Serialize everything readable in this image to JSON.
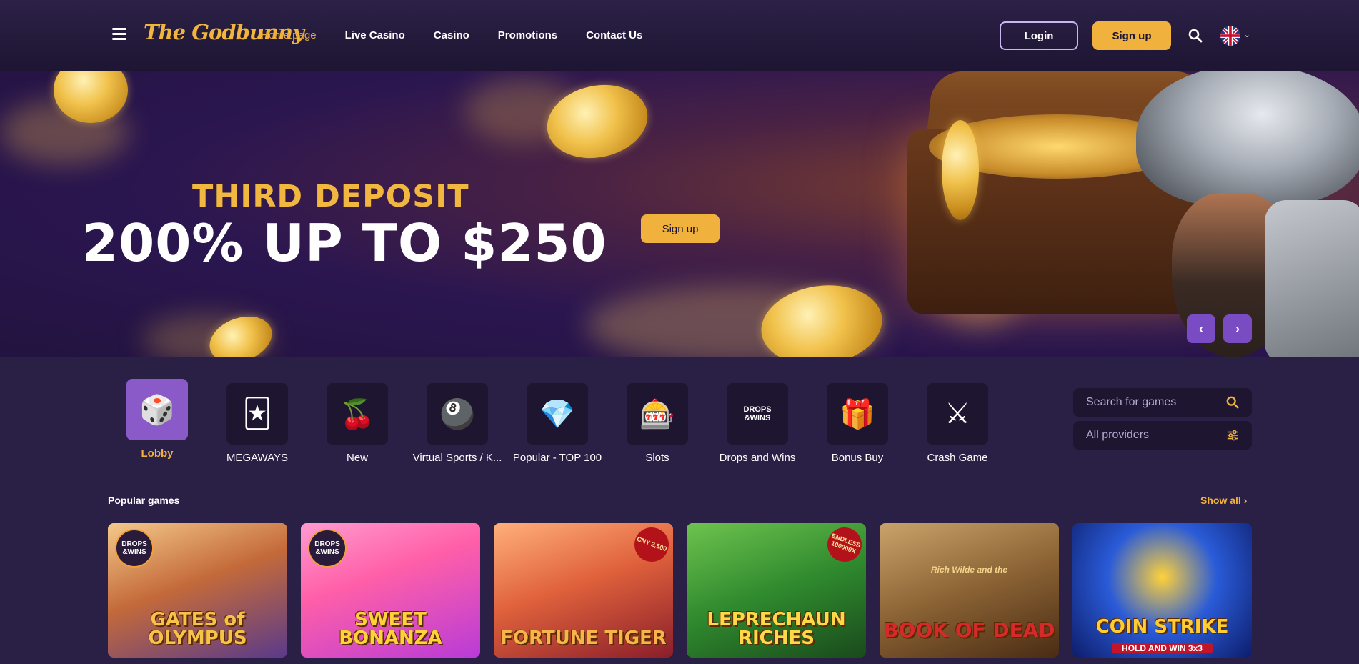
{
  "header": {
    "logo": "The Godbunny",
    "nav": [
      "Home page",
      "Live Casino",
      "Casino",
      "Promotions",
      "Contact Us"
    ],
    "login_label": "Login",
    "signup_label": "Sign up"
  },
  "banner": {
    "subtitle": "THIRD DEPOSIT",
    "headline": "200% UP TO $250",
    "cta_label": "Sign up",
    "prev_glyph": "‹",
    "next_glyph": "›"
  },
  "categories": [
    {
      "label": "Lobby",
      "icon": "dice-icon",
      "glyph": "🎲",
      "active": true
    },
    {
      "label": "MEGAWAYS",
      "icon": "jester-hat-icon",
      "glyph": "🃏"
    },
    {
      "label": "New",
      "icon": "cherries-icon",
      "glyph": "🍒"
    },
    {
      "label": "Virtual Sports / K...",
      "icon": "lottery-ball-icon",
      "glyph": "🎱"
    },
    {
      "label": "Popular - TOP 100",
      "icon": "diamond-icon",
      "glyph": "💎"
    },
    {
      "label": "Slots",
      "icon": "slot-777-icon",
      "glyph": "🎰"
    },
    {
      "label": "Drops and Wins",
      "icon": "drops-wins-icon",
      "glyph": "DROPS\n&WINS"
    },
    {
      "label": "Bonus Buy",
      "icon": "gift-box-icon",
      "glyph": "🎁"
    },
    {
      "label": "Crash Game",
      "icon": "crossed-swords-icon",
      "glyph": "⚔"
    }
  ],
  "search": {
    "placeholder": "Search for games"
  },
  "providers": {
    "label": "All providers"
  },
  "popular": {
    "title": "Popular games",
    "show_all": "Show all",
    "games": [
      {
        "title": "GATES of OLYMPUS",
        "badge": "DROPS &WINS",
        "title_color": "#f6c24a"
      },
      {
        "title": "SWEET BONANZA",
        "badge": "DROPS &WINS",
        "title_color": "#ffd23a"
      },
      {
        "title": "FORTUNE TIGER",
        "tag": "CNY 2,500",
        "title_color": "#f7b44a"
      },
      {
        "title": "LEPRECHAUN RICHES",
        "tag": "ENDLESS 100000X",
        "title_color": "#ffd84a"
      },
      {
        "title": "BOOK OF DEAD",
        "subtitle": "Rich Wilde and the",
        "title_color": "#d7292b"
      },
      {
        "title": "COIN STRIKE",
        "subtitle": "HOLD AND WIN 3x3",
        "title_color": "#ffcc33"
      }
    ]
  },
  "colors": {
    "accent": "#f0b23c",
    "background": "#2a1f45",
    "tile": "#1e1630",
    "active_tile": "#8a5ac8",
    "slider_button": "#7a4cc4"
  }
}
